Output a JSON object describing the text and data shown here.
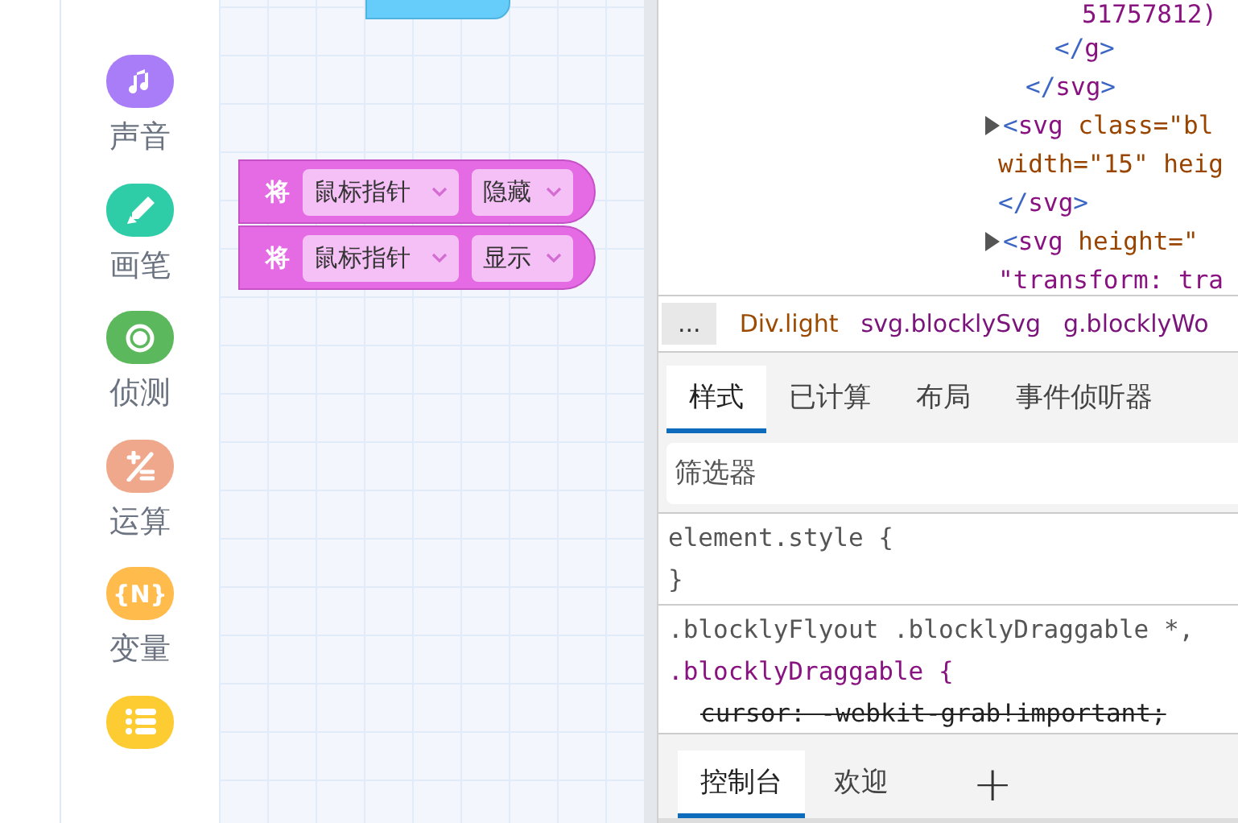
{
  "categories": [
    {
      "kind": "music",
      "label": "声音",
      "color": "#a97cf8"
    },
    {
      "kind": "pen",
      "label": "画笔",
      "color": "#2ecca7"
    },
    {
      "kind": "ring",
      "label": "侦测",
      "color": "#5cb85c"
    },
    {
      "kind": "math",
      "label": "运算",
      "color": "#f0a88c"
    },
    {
      "kind": "text",
      "glyph": "{N}",
      "label": "变量",
      "color": "#ffbb4c"
    },
    {
      "kind": "list",
      "color": "#fdcc33"
    }
  ],
  "blocks": [
    {
      "verb": "将",
      "target": "鼠标指针",
      "action": "隐藏"
    },
    {
      "verb": "将",
      "target": "鼠标指针",
      "action": "显示"
    }
  ],
  "dom_lines": [
    {
      "kind": "text",
      "segments": [
        {
          "kind": "value",
          "text": "51757812)"
        }
      ]
    },
    {
      "kind": "close",
      "segments": [
        {
          "kind": "tag",
          "text": "</"
        },
        {
          "kind": "name",
          "text": "g"
        },
        {
          "kind": "tag",
          "text": ">"
        }
      ]
    },
    {
      "kind": "close",
      "segments": [
        {
          "kind": "tag",
          "text": "</"
        },
        {
          "kind": "name",
          "text": "svg"
        },
        {
          "kind": "tag",
          "text": ">"
        }
      ]
    },
    {
      "kind": "open",
      "expanded": false,
      "segments": [
        {
          "kind": "tag",
          "text": "<"
        },
        {
          "kind": "name",
          "text": "svg"
        },
        {
          "kind": "attr",
          "text": " class=\"bl"
        }
      ]
    },
    {
      "kind": "cont",
      "segments": [
        {
          "kind": "attr",
          "text": "width=\"15\" heig"
        }
      ]
    },
    {
      "kind": "cont",
      "segments": [
        {
          "kind": "tag",
          "text": "</"
        },
        {
          "kind": "name",
          "text": "svg"
        },
        {
          "kind": "tag",
          "text": ">"
        }
      ]
    },
    {
      "kind": "open",
      "expanded": false,
      "segments": [
        {
          "kind": "tag",
          "text": "<"
        },
        {
          "kind": "name",
          "text": "svg"
        },
        {
          "kind": "attr",
          "text": " height=\""
        }
      ]
    },
    {
      "kind": "cont",
      "segments": [
        {
          "kind": "value",
          "text": "\"transform: tra"
        }
      ]
    }
  ],
  "breadcrumbs": [
    {
      "text": "...",
      "kind": "more"
    },
    {
      "text": "Div.light",
      "kind": "element"
    },
    {
      "text": "svg.blocklySvg",
      "kind": "svg"
    },
    {
      "text": "g.blocklyWo",
      "kind": "svg"
    }
  ],
  "tabs": [
    {
      "label": "样式",
      "selected": true
    },
    {
      "label": "已计算",
      "selected": false
    },
    {
      "label": "布局",
      "selected": false
    },
    {
      "label": "事件侦听器",
      "selected": false
    }
  ],
  "filter": {
    "placeholder": "筛选器"
  },
  "rules": [
    {
      "lines": [
        {
          "kind": "selector",
          "text": "element.style {"
        },
        {
          "kind": "plain",
          "text": "}"
        }
      ]
    },
    {
      "lines": [
        {
          "kind": "selector",
          "text": ".blocklyFlyout .blocklyDraggable *,"
        },
        {
          "kind": "selector2",
          "text": ".blocklyDraggable {"
        },
        {
          "kind": "prop",
          "text": "cursor: -webkit-grab!important;",
          "struck": true
        }
      ]
    }
  ],
  "drawer_tabs": [
    {
      "label": "控制台",
      "selected": true
    },
    {
      "label": "欢迎",
      "selected": false
    }
  ],
  "add_tab": "+"
}
